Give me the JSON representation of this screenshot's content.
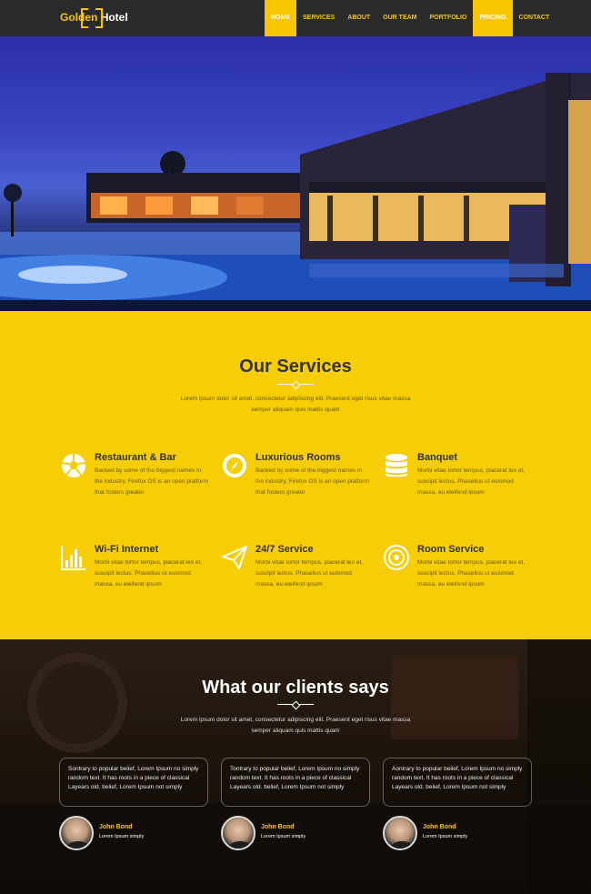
{
  "header": {
    "logo_part1": "Golden",
    "logo_part2": "Hotel",
    "menu": [
      {
        "label": "HOME"
      },
      {
        "label": "SERVICES"
      },
      {
        "label": "ABOUT"
      },
      {
        "label": "OUR TEAM"
      },
      {
        "label": "PORTFOLIO"
      },
      {
        "label": "PRICING"
      },
      {
        "label": "CONTACT"
      }
    ]
  },
  "hero": {
    "slides_count": 3,
    "active_slide": 1
  },
  "services": {
    "title": "Our Services",
    "subtitle": "Lorem ipsum dolor sit amet, consectetur adipiscing elit. Praesent eget risus vitae massa semper aliquam quis mattis quam",
    "items": [
      {
        "title": "Restaurant & Bar",
        "text": "Backed by some of the biggest names in the industry, Firefox OS is an open platform that fosters greater",
        "icon": "soccer-ball-icon"
      },
      {
        "title": "Luxurious Rooms",
        "text": "Backed by some of the biggest names in the industry, Firefox OS is an open platform that fosters greater",
        "icon": "compass-icon"
      },
      {
        "title": "Banquet",
        "text": "Morbi vitae tortor tempus, placerat leo et, suscipit lectus. Phasellus ut euismod massa, eu eleifend ipsum",
        "icon": "database-icon"
      },
      {
        "title": "Wi-Fi Internet",
        "text": "Morbi vitae tortor tempus, placerat leo et, suscipit lectus. Phasellus ut euismod massa, eu eleifend ipsum",
        "icon": "bar-chart-icon"
      },
      {
        "title": "24/7 Service",
        "text": "Morbi vitae tortor tempus, placerat leo et, suscipit lectus. Phasellus ut euismod massa, eu eleifend ipsum",
        "icon": "paper-plane-icon"
      },
      {
        "title": "Room Service",
        "text": "Morbi vitae tortor tempus, placerat leo et, suscipit lectus. Phasellus ut euismod massa, eu eleifend ipsum",
        "icon": "target-icon"
      }
    ]
  },
  "clients": {
    "title": "What our clients says",
    "subtitle": "Lorem ipsum dolor sit amet, consectetur adipiscing elit. Praesent eget risus vitae massa semper aliquam quis mattis quam",
    "testimonials": [
      {
        "quote": "Sontrary to popular belief, Lorem Ipsum no simply random text. It has roots in a piece of classical Layears old. belief, Lorem Ipsum not simply",
        "name": "John Bond",
        "role": "Lorem Ipsum simply"
      },
      {
        "quote": "Tontrary to popular belief, Lorem Ipsum no simply random text. It has roots in a piece of classical Layears old. belief, Lorem Ipsum not simply",
        "name": "John Bond",
        "role": "Lorem Ipsum simply"
      },
      {
        "quote": "Aontrary to popular belief, Lorem Ipsum no simply random text. It has roots in a piece of classical Layears old. belief, Lorem Ipsum not simply",
        "name": "John Bond",
        "role": "Lorem Ipsum simply"
      }
    ]
  },
  "colors": {
    "accent": "#f7c600",
    "services_bg": "#f7cd06",
    "nav_bg": "#2a2a2a"
  }
}
